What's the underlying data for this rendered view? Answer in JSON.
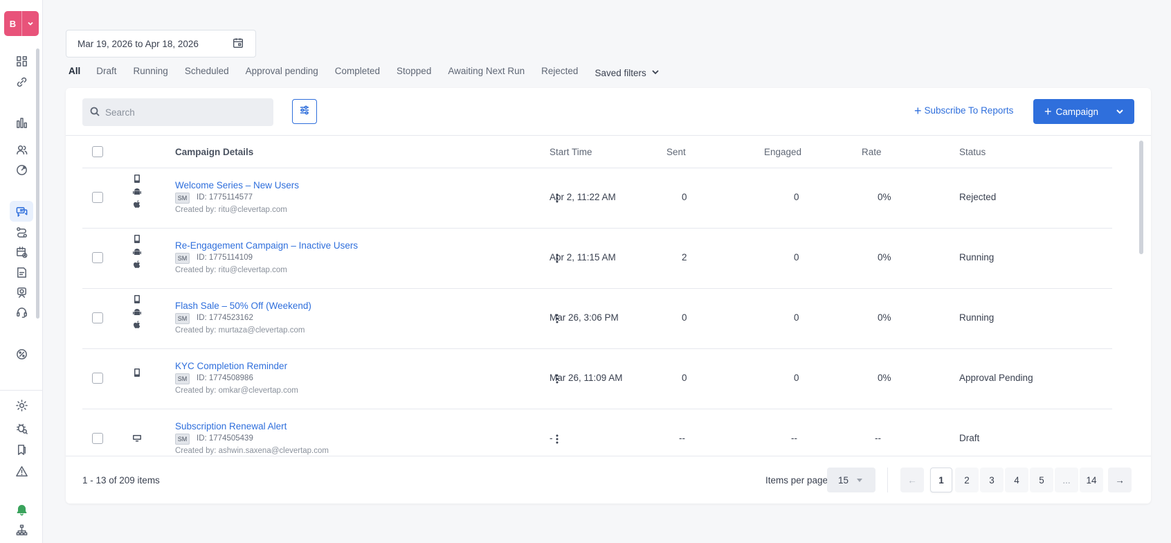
{
  "brand": {
    "initial": "B"
  },
  "date_range": "Mar 19, 2026 to Apr 18, 2026",
  "tabs": [
    "All",
    "Draft",
    "Running",
    "Scheduled",
    "Approval pending",
    "Completed",
    "Stopped",
    "Awaiting Next Run",
    "Rejected"
  ],
  "saved_filters_label": "Saved filters",
  "search": {
    "placeholder": "Search"
  },
  "subscribe_label": "Subscribe To Reports",
  "campaign_button_label": "Campaign",
  "columns": {
    "details": "Campaign Details",
    "start": "Start Time",
    "sent": "Sent",
    "engaged": "Engaged",
    "rate": "Rate",
    "status": "Status"
  },
  "rows": [
    {
      "name": "Welcome Series – New Users",
      "badge": "SM",
      "id": "ID: 1775114577",
      "creator": "Created by: ritu@clevertap.com",
      "start": "Apr 2, 11:22 AM",
      "sent": "0",
      "engaged": "0",
      "rate": "0%",
      "status": "Rejected",
      "platforms": [
        "mobile-icon",
        "android-icon",
        "apple-icon"
      ]
    },
    {
      "name": "Re-Engagement Campaign – Inactive Users",
      "badge": "SM",
      "id": "ID: 1775114109",
      "creator": "Created by: ritu@clevertap.com",
      "start": "Apr 2, 11:15 AM",
      "sent": "2",
      "engaged": "0",
      "rate": "0%",
      "status": "Running",
      "platforms": [
        "mobile-icon",
        "android-icon",
        "apple-icon"
      ]
    },
    {
      "name": "Flash Sale – 50% Off (Weekend)",
      "badge": "SM",
      "id": "ID: 1774523162",
      "creator": "Created by: murtaza@clevertap.com",
      "start": "Mar 26, 3:06 PM",
      "sent": "0",
      "engaged": "0",
      "rate": "0%",
      "status": "Running",
      "platforms": [
        "mobile-icon",
        "android-icon",
        "apple-icon"
      ]
    },
    {
      "name": "KYC Completion Reminder",
      "badge": "SM",
      "id": "ID: 1774508986",
      "creator": "Created by: omkar@clevertap.com",
      "start": "Mar 26, 11:09 AM",
      "sent": "0",
      "engaged": "0",
      "rate": "0%",
      "status": "Approval Pending",
      "platforms": [
        "mobile-icon"
      ]
    },
    {
      "name": "Subscription Renewal Alert",
      "badge": "SM",
      "id": "ID: 1774505439",
      "creator": "Created by: ashwin.saxena@clevertap.com",
      "start": "-",
      "sent": "--",
      "engaged": "--",
      "rate": "--",
      "status": "Draft",
      "platforms": [
        "desktop-icon"
      ]
    }
  ],
  "pagination": {
    "range": "1 - 13 of 209 items",
    "items_per_page_label": "Items per page",
    "items_per_page": "15",
    "pages": [
      "1",
      "2",
      "3",
      "4",
      "5",
      "...",
      "14"
    ],
    "prev": "←",
    "next": "→"
  }
}
